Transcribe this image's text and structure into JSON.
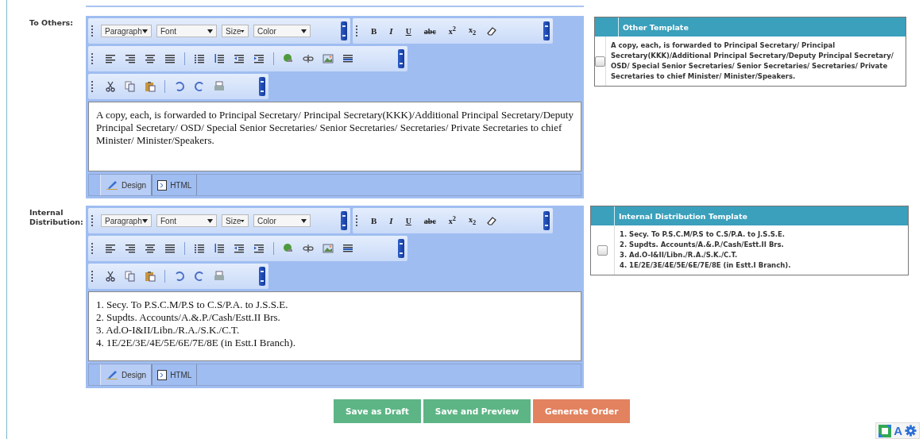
{
  "sections": [
    {
      "label": "To Others:",
      "dropdowns": [
        "Paragraph",
        "Font",
        "Size",
        "Color"
      ],
      "format_buttons": [
        "B",
        "I",
        "U",
        "abc",
        "x$^{2}$",
        "x$_{2}$"
      ],
      "content_lines": [
        "A copy, each, is forwarded to Principal Secretary/ Principal Secretary(KKK)/Additional Principal Secretary/Deputy Principal Secretary/ OSD/ Special Senior Secretaries/ Senior Secretaries/ Secretaries/ Private Secretaries to chief Minister/ Minister/Speakers."
      ],
      "tabs": [
        {
          "label": "Design",
          "selected": true
        },
        {
          "label": "HTML",
          "selected": false
        }
      ],
      "template": {
        "title": "Other Template",
        "checked": false,
        "lines": [
          "A copy, each, is forwarded to Principal Secretary/ Principal Secretary(KKK)/Additional Principal Secretary/Deputy Principal Secretary/ OSD/ Special Senior Secretaries/ Senior Secretaries/ Secretaries/ Private Secretaries to chief Minister/ Minister/Speakers."
        ]
      }
    },
    {
      "label": "Internal Distribution:",
      "dropdowns": [
        "Paragraph",
        "Font",
        "Size",
        "Color"
      ],
      "format_buttons": [
        "B",
        "I",
        "U",
        "abc",
        "x$^{2}$",
        "x$_{2}$"
      ],
      "content_lines": [
        "1. Secy. To P.S.C.M/P.S to C.S/P.A. to J.S.S.E.",
        "2. Supdts. Accounts/A.&.P./Cash/Estt.II Brs.",
        "3. Ad.O-I&II/Libn./R.A./S.K./C.T.",
        "4. 1E/2E/3E/4E/5E/6E/7E/8E (in Estt.I Branch)."
      ],
      "tabs": [
        {
          "label": "Design",
          "selected": true
        },
        {
          "label": "HTML",
          "selected": false
        }
      ],
      "template": {
        "title": "Internal Distribution Template",
        "checked": false,
        "lines": [
          "1. Secy. To P.S.C.M/P.S to C.S/P.A. to J.S.S.E.",
          "2. Supdts. Accounts/A.&.P./Cash/Estt.II Brs.",
          "3. Ad.O-I&II/Libn./R.A./S.K./C.T.",
          "4. 1E/2E/3E/4E/5E/6E/7E/8E (in Estt.I Branch)."
        ]
      }
    }
  ],
  "buttons": [
    {
      "label": "Save as Draft",
      "kind": "secondary"
    },
    {
      "label": "Save and Preview",
      "kind": "secondary"
    },
    {
      "label": "Generate Order",
      "kind": "primary"
    }
  ],
  "corner_widget": {
    "letter": "A"
  }
}
